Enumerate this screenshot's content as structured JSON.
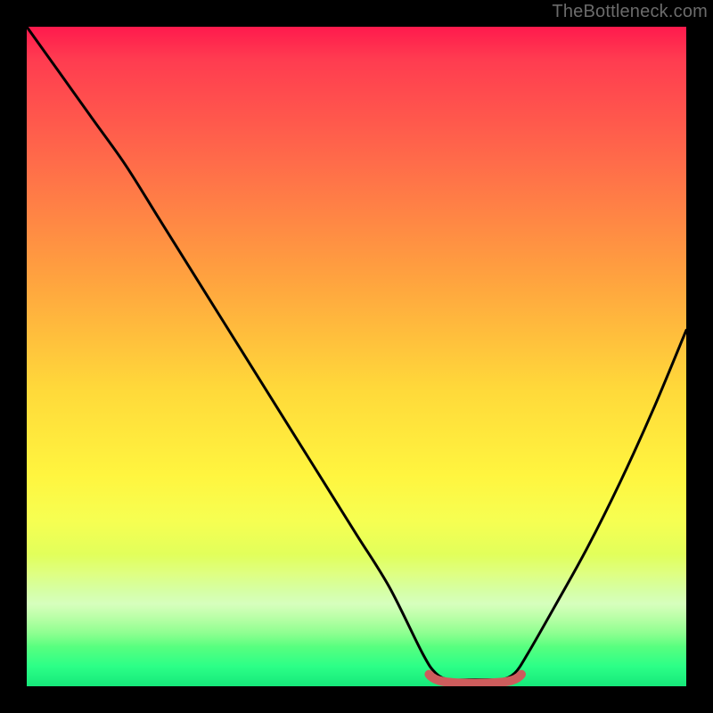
{
  "watermark": {
    "text": "TheBottleneck.com"
  },
  "colors": {
    "frame": "#000000",
    "curve": "#000000",
    "marker": "#cd5c5c",
    "gradient_top": "#ff1a4d",
    "gradient_mid": "#fff53f",
    "gradient_bottom": "#16e87a"
  },
  "chart_data": {
    "type": "line",
    "title": "",
    "xlabel": "",
    "ylabel": "",
    "xlim": [
      0,
      100
    ],
    "ylim": [
      0,
      100
    ],
    "grid": false,
    "legend": false,
    "x": [
      0,
      5,
      10,
      15,
      20,
      25,
      30,
      35,
      40,
      45,
      50,
      55,
      60,
      62,
      64,
      67,
      70,
      72,
      74,
      76,
      80,
      85,
      90,
      95,
      100
    ],
    "values": [
      100,
      93,
      86,
      79,
      71,
      63,
      55,
      47,
      39,
      31,
      23,
      15,
      5,
      2,
      1,
      1,
      1,
      1,
      2,
      5,
      12,
      21,
      31,
      42,
      54
    ],
    "floor_band": {
      "x0": 61,
      "x1": 75,
      "y": 1
    },
    "annotations": []
  }
}
